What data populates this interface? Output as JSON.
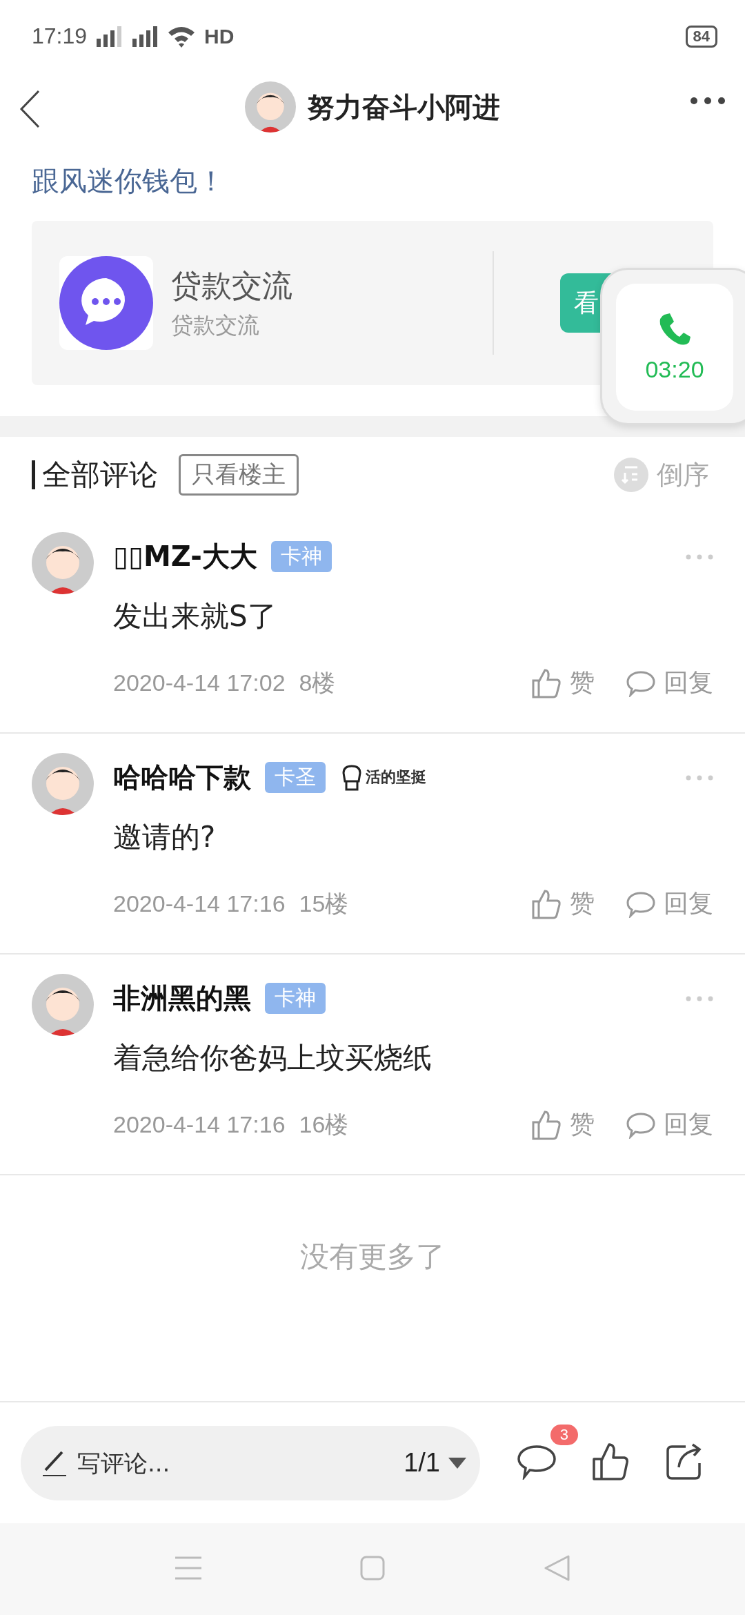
{
  "status_bar": {
    "time": "17:19",
    "hd": "HD",
    "battery": "84"
  },
  "header": {
    "title": "努力奋斗小阿进"
  },
  "post": {
    "text": "跟风迷你钱包！"
  },
  "share_card": {
    "title": "贷款交流",
    "subtitle": "贷款交流",
    "button": "看"
  },
  "call_widget": {
    "timer": "03:20"
  },
  "comments_header": {
    "title": "全部评论",
    "filter": "只看楼主",
    "filter_selected": false,
    "sort": "倒序"
  },
  "comments": [
    {
      "name": "▯▯MZ-大大",
      "badge": "卡神",
      "text": "发出来就S了",
      "time": "2020-4-14 17:02",
      "floor": "8楼",
      "like": "赞",
      "reply": "回复"
    },
    {
      "name": "哈哈哈下款",
      "badge": "卡圣",
      "medal": "活的坚挺",
      "text": "邀请的?",
      "time": "2020-4-14 17:16",
      "floor": "15楼",
      "like": "赞",
      "reply": "回复"
    },
    {
      "name": "非洲黑的黑",
      "badge": "卡神",
      "text": "着急给你爸妈上坟买烧纸",
      "time": "2020-4-14 17:16",
      "floor": "16楼",
      "like": "赞",
      "reply": "回复"
    }
  ],
  "end_text": "没有更多了",
  "bottom_bar": {
    "placeholder": "写评论...",
    "page": "1/1",
    "comment_count": "3"
  }
}
